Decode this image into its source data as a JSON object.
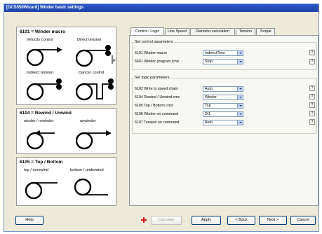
{
  "window": {
    "title": "[DCS550Wizard] Winder basic settings"
  },
  "left": {
    "macro": {
      "title": "6101 = Winder macro",
      "labels": [
        "Velocity control",
        "Direct tension",
        "Indirect tension",
        "Dancer control"
      ],
      "marker": "F"
    },
    "rewind": {
      "title": "6104 = Rewind / Unwind",
      "labels": [
        "winder / rewinder",
        "unwinder"
      ]
    },
    "topbottom": {
      "title": "6105 = Top / Bottom",
      "labels": [
        "top / overwind",
        "bottom / underwind"
      ]
    }
  },
  "tabs": [
    "Control / Logic",
    "Line Speed",
    "Diameter calculation",
    "Tension",
    "Torque"
  ],
  "control": {
    "title": "Set control parameters",
    "rows": [
      {
        "label": "6101 Winder macro",
        "value": "IndirectTens"
      },
      {
        "label": "6601 Winder program cmd",
        "value": "Stop"
      }
    ]
  },
  "logic": {
    "title": "Set logic parameters",
    "rows": [
      {
        "label": "6102 Write to speed chain",
        "value": "Auto"
      },
      {
        "label": "6104 Rewind / Unwind cmc",
        "value": "Winder"
      },
      {
        "label": "6105 Top / Bottom cmd",
        "value": "Top"
      },
      {
        "label": "6106 Winder on command",
        "value": "DI1"
      },
      {
        "label": "6107 Tension on command",
        "value": "Auto"
      }
    ]
  },
  "help_marker": "?",
  "buttons": {
    "help": "Help",
    "calculate": "Calculate",
    "apply": "Apply",
    "back": "< Back",
    "next": "Next >",
    "cancel": "Cancel"
  },
  "colors": {
    "titlebar": "#1f40a8",
    "accent_red": "#d01818"
  }
}
